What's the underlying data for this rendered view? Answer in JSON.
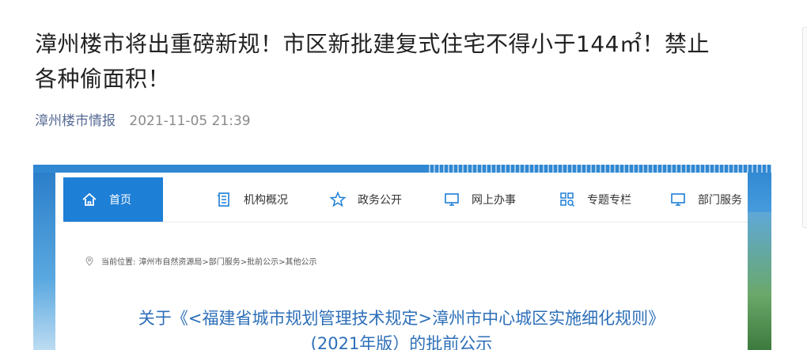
{
  "article": {
    "title_line1": "漳州楼市将出重磅新规！市区新批建复式住宅不得小于144㎡！禁止",
    "title_line2": "各种偷面积！",
    "account": "漳州楼市情报",
    "datetime": "2021-11-05 21:39"
  },
  "embed": {
    "nav": [
      {
        "label": "首页",
        "icon": "home-icon",
        "active": true
      },
      {
        "label": "机构概况",
        "icon": "document-icon",
        "active": false
      },
      {
        "label": "政务公开",
        "icon": "star-icon",
        "active": false
      },
      {
        "label": "网上办事",
        "icon": "monitor-icon",
        "active": false
      },
      {
        "label": "专题专栏",
        "icon": "grid-search-icon",
        "active": false
      },
      {
        "label": "部门服务",
        "icon": "monitor-icon",
        "active": false
      }
    ],
    "breadcrumb": {
      "prefix": "当前位置:",
      "path": "漳州市自然资源局>部门服务>批前公示>其他公示"
    },
    "notice": {
      "title_line1": "关于《<福建省城市规划管理技术规定>漳州市中心城区实施细化规则》",
      "title_line2": "(2021年版）的批前公示"
    }
  },
  "colors": {
    "accent": "#1e7fd6",
    "account_link": "#576b95",
    "notice_title": "#2d6fb8"
  }
}
